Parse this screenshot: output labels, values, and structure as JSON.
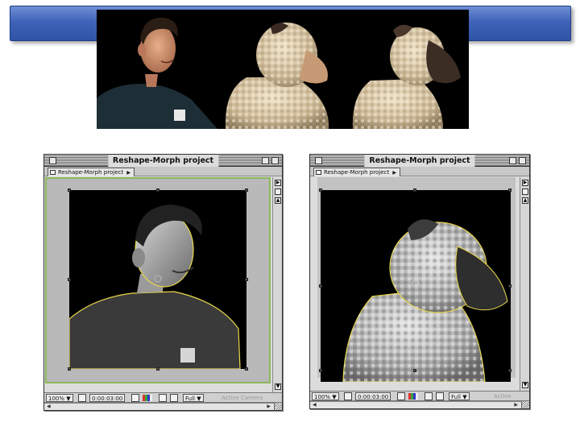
{
  "slide": {
    "header_color": "#3f63b8"
  },
  "top_strip": {
    "frames": [
      "man",
      "man-sheep-morph",
      "sheep"
    ]
  },
  "windows": [
    {
      "title": "Reshape-Morph project",
      "tab_label": "Reshape-Morph project",
      "zoom": "100%",
      "timecode": "0:00:03:00",
      "resolution": "Full",
      "camera": "Active Camera",
      "subject": "man",
      "mask_color": "#e8d84a"
    },
    {
      "title": "Reshape-Morph project",
      "tab_label": "Reshape-Morph project",
      "zoom": "100%",
      "timecode": "0:00:03:00",
      "resolution": "Full",
      "camera": "Active",
      "subject": "sheep",
      "mask_color": "#e8d84a"
    }
  ],
  "icons": {
    "close": "close-box-icon",
    "zoom": "zoom-box-icon",
    "shade": "windowshade-box-icon",
    "grow": "grow-box-icon"
  }
}
